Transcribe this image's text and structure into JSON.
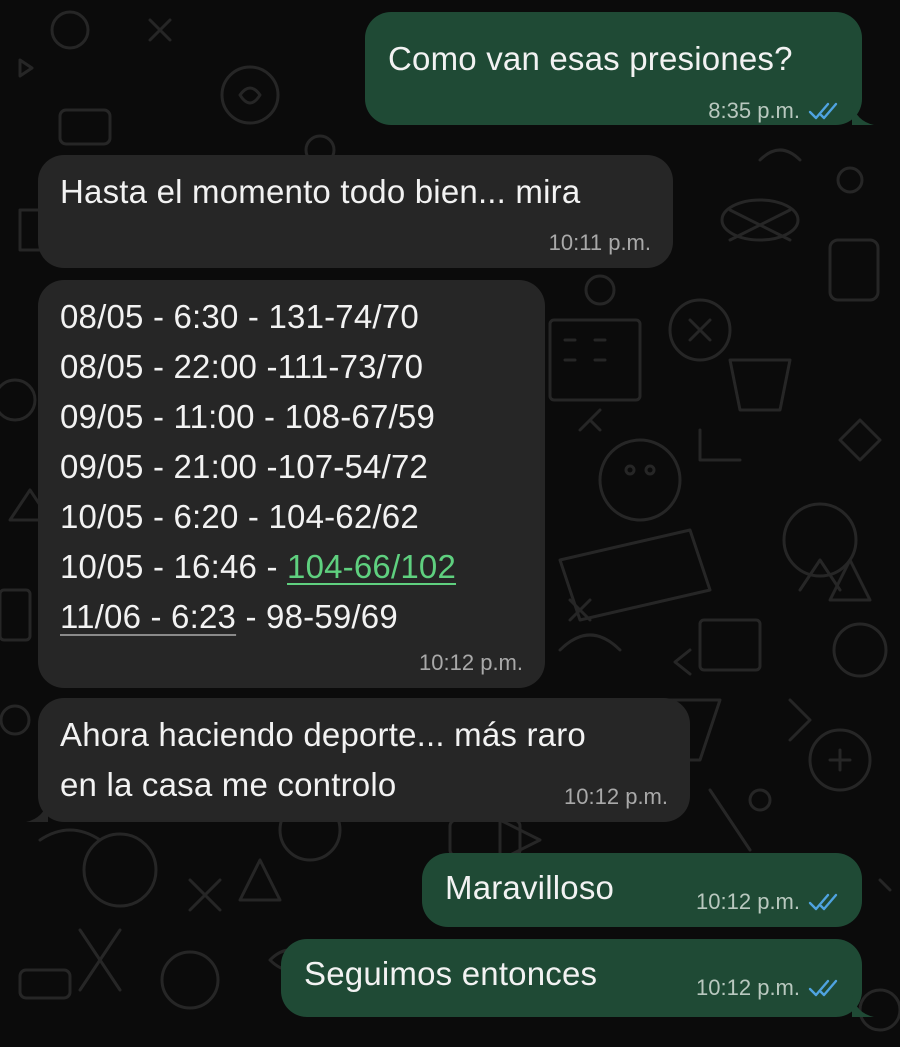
{
  "theme": {
    "incoming_bubble": "#262626",
    "outgoing_bubble": "#1f4a35",
    "read_tick_color": "#4fa3e0",
    "link_color": "#5fd07f"
  },
  "messages": [
    {
      "direction": "outgoing",
      "text": "Como van esas presiones?",
      "time": "8:35 p.m.",
      "status_icon": "double-check-read-icon"
    },
    {
      "direction": "incoming",
      "text": "Hasta el momento todo bien... mira",
      "time": "10:11 p.m."
    },
    {
      "direction": "incoming",
      "readings": [
        {
          "a": "08/05 - 6:30 - 131-74/70"
        },
        {
          "a": "08/05 - 22:00 -111-73/70"
        },
        {
          "a": "09/05 - 11:00 - 108-67/59"
        },
        {
          "a": "09/05 - 21:00 -107-54/72"
        },
        {
          "a": "10/05 - 6:20 - 104-62/62"
        },
        {
          "a": "10/05 - 16:46 - ",
          "link": "104-66/102"
        },
        {
          "a": "11/06 - 6:23",
          "b": " - 98-59/69"
        }
      ],
      "time": "10:12 p.m."
    },
    {
      "direction": "incoming",
      "line1": "Ahora haciendo deporte... más raro",
      "line2": "en la casa me controlo",
      "time": "10:12 p.m."
    },
    {
      "direction": "outgoing",
      "text": "Maravilloso",
      "time": "10:12 p.m.",
      "status_icon": "double-check-read-icon"
    },
    {
      "direction": "outgoing",
      "text": "Seguimos entonces",
      "time": "10:12 p.m.",
      "status_icon": "double-check-read-icon"
    }
  ]
}
